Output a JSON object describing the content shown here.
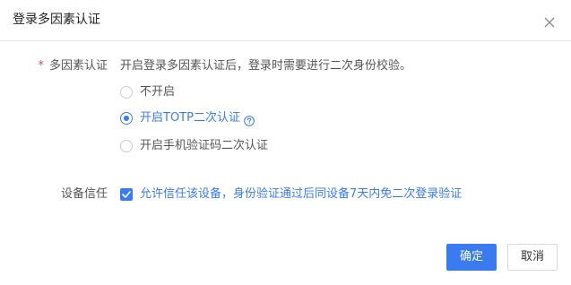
{
  "dialog": {
    "title": "登录多因素认证",
    "close_icon": "close-icon"
  },
  "form": {
    "mfa": {
      "required_mark": "*",
      "label": "多因素认证",
      "hint": "开启登录多因素认证后，登录时需要进行二次身份校验。",
      "options": [
        {
          "label": "不开启",
          "selected": false
        },
        {
          "label": "开启TOTP二次认证",
          "selected": true,
          "help_icon": "question-circle-icon"
        },
        {
          "label": "开启手机验证码二次认证",
          "selected": false
        }
      ]
    },
    "trust": {
      "label": "设备信任",
      "checkbox_label": "允许信任该设备，身份验证通过后同设备7天内免二次登录验证",
      "checked": true
    }
  },
  "footer": {
    "confirm_label": "确定",
    "cancel_label": "取消"
  },
  "colors": {
    "accent": "#3a7cf0",
    "required": "#e34d4d"
  }
}
